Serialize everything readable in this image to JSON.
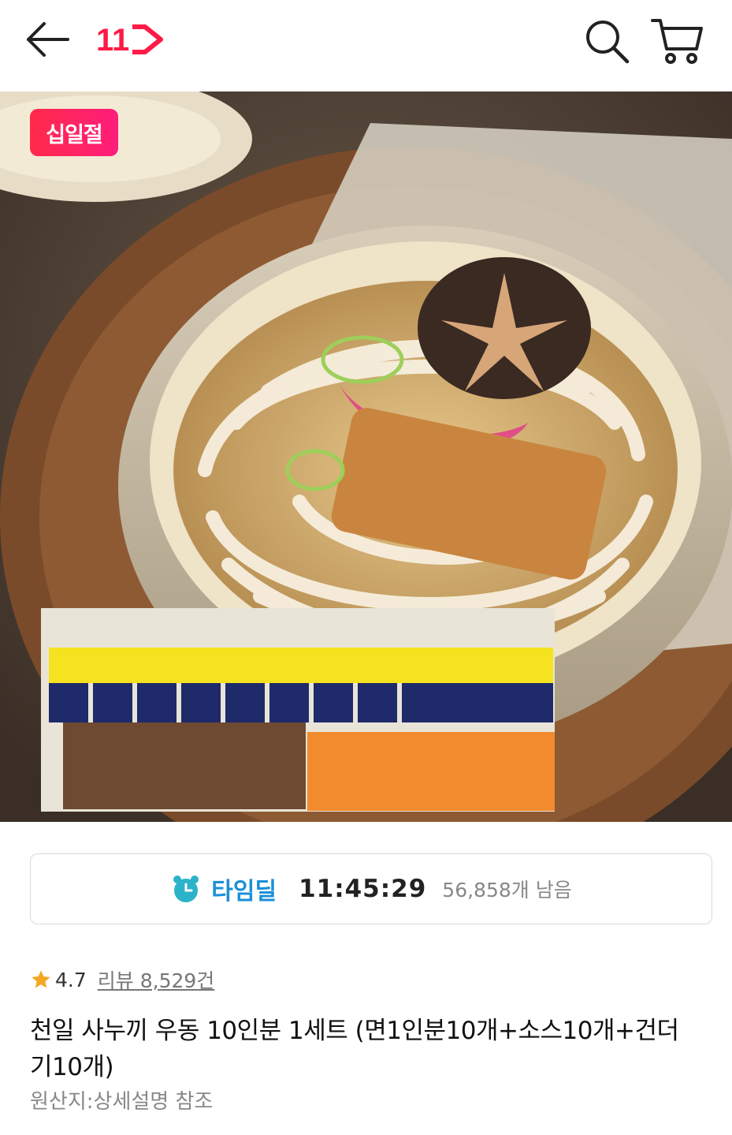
{
  "header": {
    "logo_text": "11",
    "icons": [
      "back-arrow-icon",
      "11st-logo",
      "search-icon",
      "cart-icon"
    ]
  },
  "hero": {
    "badge": "십일절",
    "colors": {
      "badge_start": "#ff2a4a",
      "badge_end": "#ff1e7c"
    }
  },
  "timedeal": {
    "label": "타임딜",
    "time": "11:45:29",
    "remaining": "56,858개 남음",
    "accent": "#1a8fd9"
  },
  "rating": {
    "value": "4.7",
    "reviews": "리뷰 8,529건",
    "star_color": "#f5a623"
  },
  "product": {
    "title": "천일 사누끼 우동 10인분 1세트 (면1인분10개+소스10개+건더기10개)",
    "origin": "원산지:상세설명 참조"
  }
}
